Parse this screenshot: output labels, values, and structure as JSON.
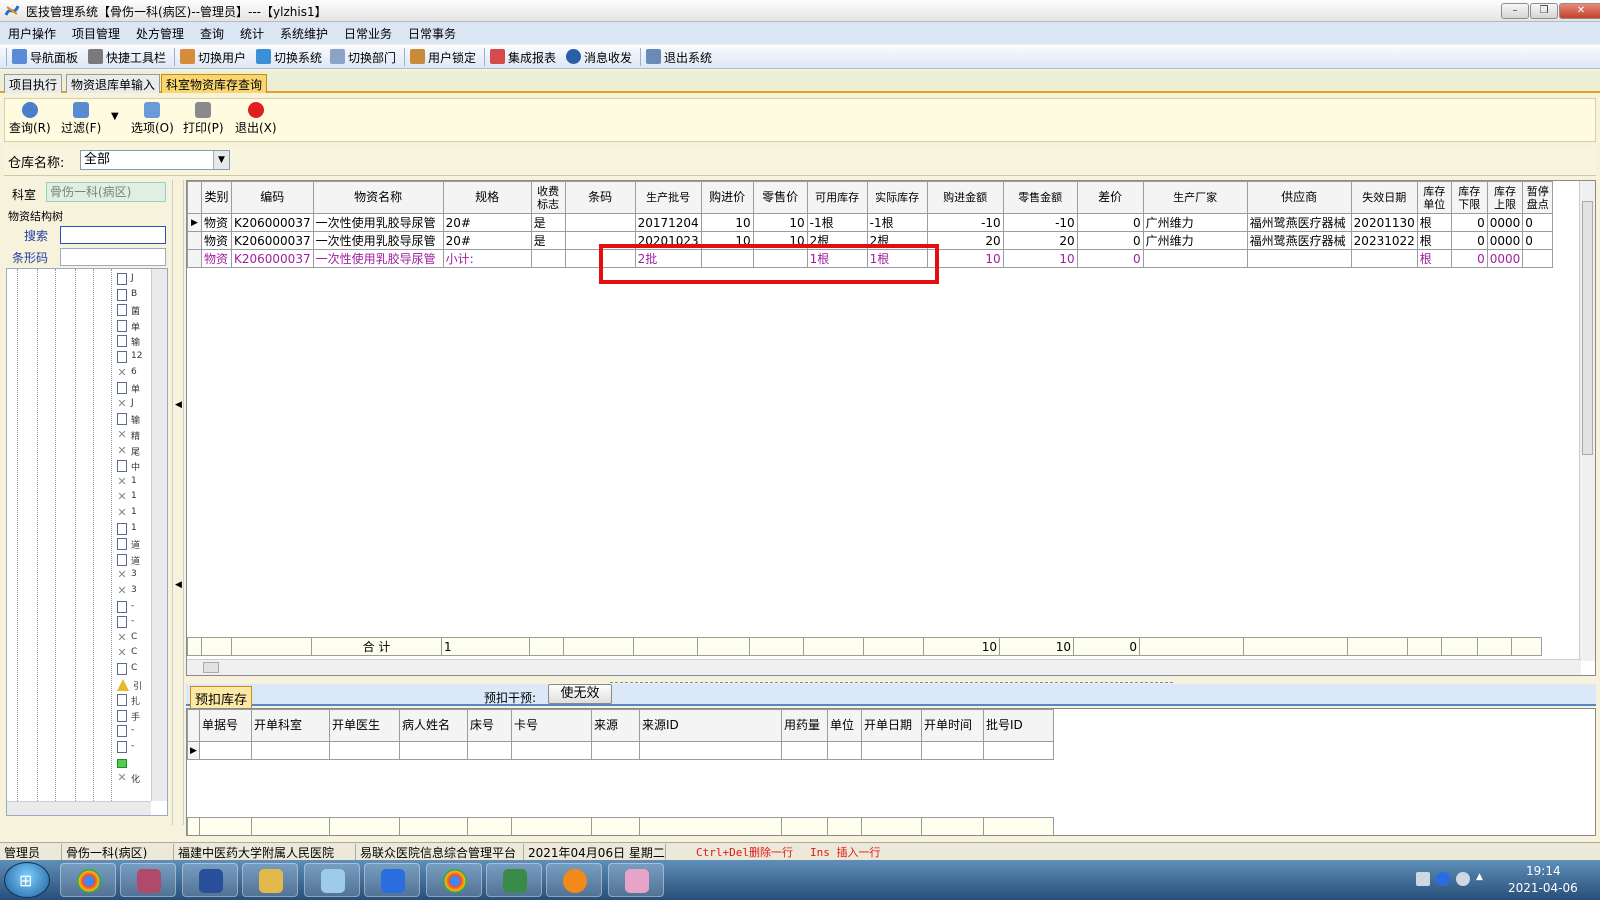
{
  "window": {
    "title": "医技管理系统【骨伤一科(病区)--管理员】---【ylzhis1】",
    "min": "–",
    "max": "❐",
    "close": "✕"
  },
  "menu": [
    "用户操作",
    "项目管理",
    "处方管理",
    "查询",
    "统计",
    "系统维护",
    "日常业务",
    "日常事务"
  ],
  "toolbar": [
    "导航面板",
    "快捷工具栏",
    "切换用户",
    "切换系统",
    "切换部门",
    "用户锁定",
    "集成报表",
    "消息收发",
    "退出系统"
  ],
  "tabs": [
    "项目执行",
    "物资退库单输入",
    "科室物资库存查询"
  ],
  "sub_toolbar": {
    "query": "查询(R)",
    "filter": "过滤(F)",
    "options": "选项(O)",
    "print": "打印(P)",
    "exit": "退出(X)"
  },
  "warehouse": {
    "label": "仓库名称:",
    "value": "全部"
  },
  "left": {
    "dept_label": "科室",
    "dept_value": "骨伤一科(病区)",
    "tree_title": "物资结构树",
    "search_label": "搜索",
    "barcode_label": "条形码"
  },
  "tree_nodes": [
    {
      "icon": "doc",
      "text": "J"
    },
    {
      "icon": "doc",
      "text": "B"
    },
    {
      "icon": "doc",
      "text": "菌"
    },
    {
      "icon": "doc",
      "text": "单"
    },
    {
      "icon": "doc",
      "text": "输"
    },
    {
      "icon": "doc",
      "text": "12"
    },
    {
      "icon": "x",
      "text": "6"
    },
    {
      "icon": "doc",
      "text": "单"
    },
    {
      "icon": "x",
      "text": "J"
    },
    {
      "icon": "doc",
      "text": "输"
    },
    {
      "icon": "x",
      "text": "精"
    },
    {
      "icon": "x",
      "text": "尾"
    },
    {
      "icon": "doc",
      "text": "中"
    },
    {
      "icon": "x",
      "text": "1"
    },
    {
      "icon": "x",
      "text": "1"
    },
    {
      "icon": "x",
      "text": "1"
    },
    {
      "icon": "doc",
      "text": "1"
    },
    {
      "icon": "doc",
      "text": "道"
    },
    {
      "icon": "doc",
      "text": "道"
    },
    {
      "icon": "x",
      "text": "3"
    },
    {
      "icon": "x",
      "text": "3"
    },
    {
      "icon": "doc",
      "text": "-"
    },
    {
      "icon": "doc",
      "text": "-"
    },
    {
      "icon": "x",
      "text": "C"
    },
    {
      "icon": "x",
      "text": "C"
    },
    {
      "icon": "doc",
      "text": "C"
    },
    {
      "icon": "warn",
      "text": "引"
    },
    {
      "icon": "doc",
      "text": "扎"
    },
    {
      "icon": "doc",
      "text": "手"
    },
    {
      "icon": "doc",
      "text": "-"
    },
    {
      "icon": "doc",
      "text": "-"
    },
    {
      "icon": "folder",
      "text": ""
    },
    {
      "icon": "x",
      "text": "化"
    }
  ],
  "grid": {
    "columns": [
      "类别",
      "编码",
      "物资名称",
      "规格",
      "收费标志",
      "条码",
      "生产批号",
      "购进价",
      "零售价",
      "可用库存",
      "实际库存",
      "购进金额",
      "零售金额",
      "差价",
      "生产厂家",
      "供应商",
      "失效日期",
      "库存单位",
      "库存下限",
      "库存上限",
      "暂停盘点"
    ],
    "rows": [
      {
        "type": "normal",
        "cells": [
          "物资",
          "K206000037",
          "一次性使用乳胶导尿管",
          "20#",
          "是",
          "",
          "20171204",
          "10",
          "10",
          "-1根",
          "-1根",
          "-10",
          "-10",
          "0",
          "广州维力",
          "福州鹭燕医疗器械",
          "20201130",
          "根",
          "0",
          "0000",
          "0"
        ]
      },
      {
        "type": "normal",
        "cells": [
          "物资",
          "K206000037",
          "一次性使用乳胶导尿管",
          "20#",
          "是",
          "",
          "20201023",
          "10",
          "10",
          "2根",
          "2根",
          "20",
          "20",
          "0",
          "广州维力",
          "福州鹭燕医疗器械",
          "20231022",
          "根",
          "0",
          "0000",
          "0"
        ]
      },
      {
        "type": "subtotal",
        "cells": [
          "物资",
          "K206000037",
          "一次性使用乳胶导尿管",
          "小计:",
          "",
          "",
          "2批",
          "",
          "",
          "1根",
          "1根",
          "10",
          "10",
          "0",
          "",
          "",
          "",
          "根",
          "0",
          "0000",
          ""
        ]
      }
    ],
    "total": {
      "label": "合 计",
      "spec": "1",
      "purchase_amount": "10",
      "retail_amount": "10",
      "diff": "0"
    }
  },
  "lower": {
    "tab": "预扣库存",
    "prededuct_label": "预扣干预:",
    "invalidate_button": "使无效",
    "columns": [
      "单据号",
      "开单科室",
      "开单医生",
      "病人姓名",
      "床号",
      "卡号",
      "来源",
      "来源ID",
      "用药量",
      "单位",
      "开单日期",
      "开单时间",
      "批号ID"
    ]
  },
  "status": [
    "管理员",
    "骨伤一科(病区)",
    "福建中医药大学附属人民医院",
    "易联众医院信息综合管理平台",
    "2021年04月06日 星期二",
    "Ctrl+Del删除一行",
    "Ins 插入一行"
  ],
  "taskbar": {
    "time": "19:14",
    "date": "2021-04-06",
    "start": "⊞"
  },
  "colors": {
    "subtotal": "#a21ca2",
    "highlight": "#e30e0e",
    "active_tab": "#f9d76f"
  }
}
